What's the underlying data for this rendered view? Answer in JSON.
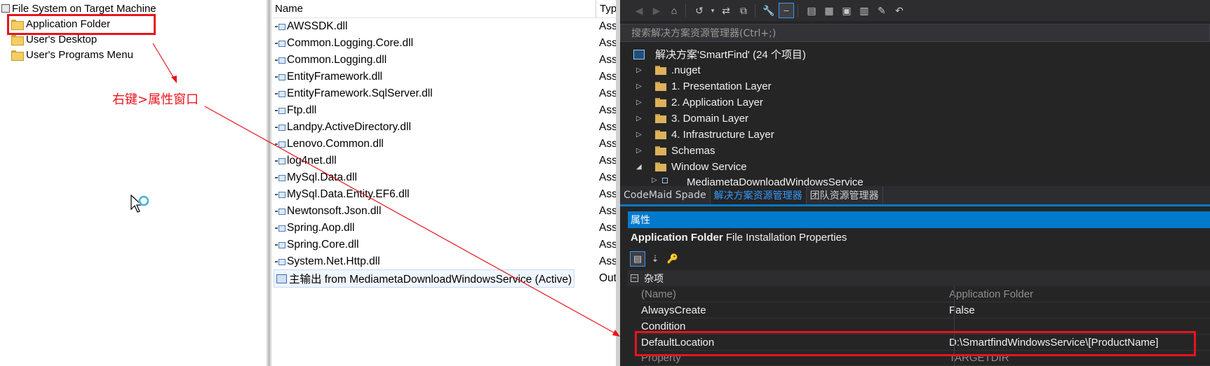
{
  "tree": {
    "root_label": "File System on Target Machine",
    "items": [
      {
        "label": "Application Folder"
      },
      {
        "label": "User's Desktop"
      },
      {
        "label": "User's Programs Menu"
      }
    ]
  },
  "annotation": {
    "text": "右键>属性窗口",
    "color": "#e8141c"
  },
  "file_list": {
    "columns": [
      "Name",
      "Typ"
    ],
    "rows": [
      {
        "name": "AWSSDK.dll",
        "type": "Ass"
      },
      {
        "name": "Common.Logging.Core.dll",
        "type": "Ass"
      },
      {
        "name": "Common.Logging.dll",
        "type": "Ass"
      },
      {
        "name": "EntityFramework.dll",
        "type": "Ass"
      },
      {
        "name": "EntityFramework.SqlServer.dll",
        "type": "Ass"
      },
      {
        "name": "Ftp.dll",
        "type": "Ass"
      },
      {
        "name": "Landpy.ActiveDirectory.dll",
        "type": "Ass"
      },
      {
        "name": "Lenovo.Common.dll",
        "type": "Ass"
      },
      {
        "name": "log4net.dll",
        "type": "Ass"
      },
      {
        "name": "MySql.Data.dll",
        "type": "Ass"
      },
      {
        "name": "MySql.Data.Entity.EF6.dll",
        "type": "Ass"
      },
      {
        "name": "Newtonsoft.Json.dll",
        "type": "Ass"
      },
      {
        "name": "Spring.Aop.dll",
        "type": "Ass"
      },
      {
        "name": "Spring.Core.dll",
        "type": "Ass"
      },
      {
        "name": "System.Net.Http.dll",
        "type": "Ass"
      },
      {
        "name": "主输出 from MediametaDownloadWindowsService (Active)",
        "type": "Out"
      }
    ]
  },
  "solution_explorer": {
    "toolbar_icons": [
      "back-icon",
      "forward-icon",
      "home-icon",
      "history-icon",
      "sync-icon",
      "collapse-icon",
      "properties-icon",
      "pending-changes-icon",
      "show-all-files-icon",
      "class-view-icon",
      "new-folder-icon",
      "preview-icon",
      "edit-icon",
      "undo-icon"
    ],
    "search_placeholder": "搜索解决方案资源管理器(Ctrl+;)",
    "solution_label": "解决方案'SmartFind' (24 个项目)",
    "nodes": [
      {
        "label": ".nuget",
        "expanded": false
      },
      {
        "label": "1. Presentation Layer",
        "expanded": false
      },
      {
        "label": "2. Application Layer",
        "expanded": false
      },
      {
        "label": "3. Domain Layer",
        "expanded": false
      },
      {
        "label": "4. Infrastructure Layer",
        "expanded": false
      },
      {
        "label": "Schemas",
        "expanded": false
      },
      {
        "label": "Window Service",
        "expanded": true
      },
      {
        "label": "MediametaDownloadWindowsService",
        "expanded": false
      }
    ]
  },
  "tabs": [
    {
      "label": "CodeMaid Spade",
      "active": false
    },
    {
      "label": "解决方案资源管理器",
      "active": true
    },
    {
      "label": "团队资源管理器",
      "active": false
    }
  ],
  "properties": {
    "title": "属性",
    "object_name": "Application Folder",
    "object_type": "File Installation Properties",
    "category": "杂项",
    "rows": [
      {
        "name": "(Name)",
        "value": "Application Folder",
        "readonly": true
      },
      {
        "name": "AlwaysCreate",
        "value": "False",
        "readonly": false
      },
      {
        "name": "Condition",
        "value": "",
        "readonly": false
      },
      {
        "name": "DefaultLocation",
        "value": "D:\\SmartfindWindowsService\\[ProductName]",
        "readonly": false
      },
      {
        "name": "Property",
        "value": "TARGETDIR",
        "readonly": true
      }
    ]
  },
  "colors": {
    "accent": "#007acc",
    "highlight": "#e8141c",
    "dark_bg": "#252526"
  }
}
